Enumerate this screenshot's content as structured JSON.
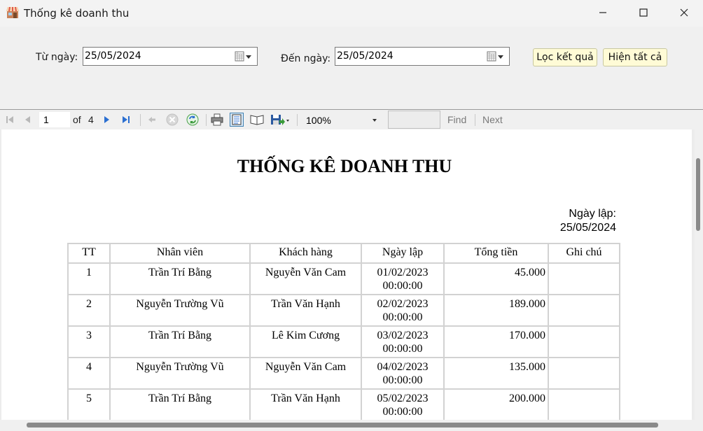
{
  "window": {
    "title": "Thống kê doanh thu",
    "icons": [
      "app-store-icon",
      "minimize-icon",
      "maximize-icon",
      "close-icon"
    ]
  },
  "filter": {
    "from_label": "Từ ngày:",
    "from_value": "25/05/2024",
    "to_label": "Đến ngày:",
    "to_value": "25/05/2024",
    "filter_button": "Lọc kết quả",
    "show_all_button": "Hiện tất cả"
  },
  "toolbar": {
    "current_page": "1",
    "of_label": "of",
    "total_pages": "4",
    "zoom": "100%",
    "find_label": "Find",
    "next_label": "Next",
    "icons": [
      "first-page-icon",
      "previous-page-icon",
      "next-page-icon",
      "last-page-icon",
      "back-icon",
      "stop-icon",
      "refresh-icon",
      "print-icon",
      "print-layout-icon",
      "page-setup-icon",
      "export-icon"
    ]
  },
  "report": {
    "title": "THỐNG KÊ DOANH THU",
    "date_label": "Ngày lập:",
    "date_value": "25/05/2024",
    "columns": [
      "TT",
      "Nhân viên",
      "Khách hàng",
      "Ngày lập",
      "Tổng tiền",
      "Ghi chú"
    ],
    "rows": [
      {
        "tt": "1",
        "nhan_vien": "Trần Trí Bằng",
        "khach_hang": "Nguyễn Văn Cam",
        "ngay": "01/02/2023",
        "gio": "00:00:00",
        "tong_tien": "45.000",
        "ghi_chu": ""
      },
      {
        "tt": "2",
        "nhan_vien": "Nguyễn Trường Vũ",
        "khach_hang": "Trần Văn Hạnh",
        "ngay": "02/02/2023",
        "gio": "00:00:00",
        "tong_tien": "189.000",
        "ghi_chu": ""
      },
      {
        "tt": "3",
        "nhan_vien": "Trần Trí Bằng",
        "khach_hang": "Lê Kim Cương",
        "ngay": "03/02/2023",
        "gio": "00:00:00",
        "tong_tien": "170.000",
        "ghi_chu": ""
      },
      {
        "tt": "4",
        "nhan_vien": "Nguyễn Trường Vũ",
        "khach_hang": "Nguyễn Văn Cam",
        "ngay": "04/02/2023",
        "gio": "00:00:00",
        "tong_tien": "135.000",
        "ghi_chu": ""
      },
      {
        "tt": "5",
        "nhan_vien": "Trần Trí Bằng",
        "khach_hang": "Trần Văn Hạnh",
        "ngay": "05/02/2023",
        "gio": "00:00:00",
        "tong_tien": "200.000",
        "ghi_chu": ""
      }
    ]
  },
  "colors": {
    "button_bg": "#fffbd6",
    "nav_blue": "#2b6fd1",
    "panel_bg": "#f0f0f0"
  }
}
